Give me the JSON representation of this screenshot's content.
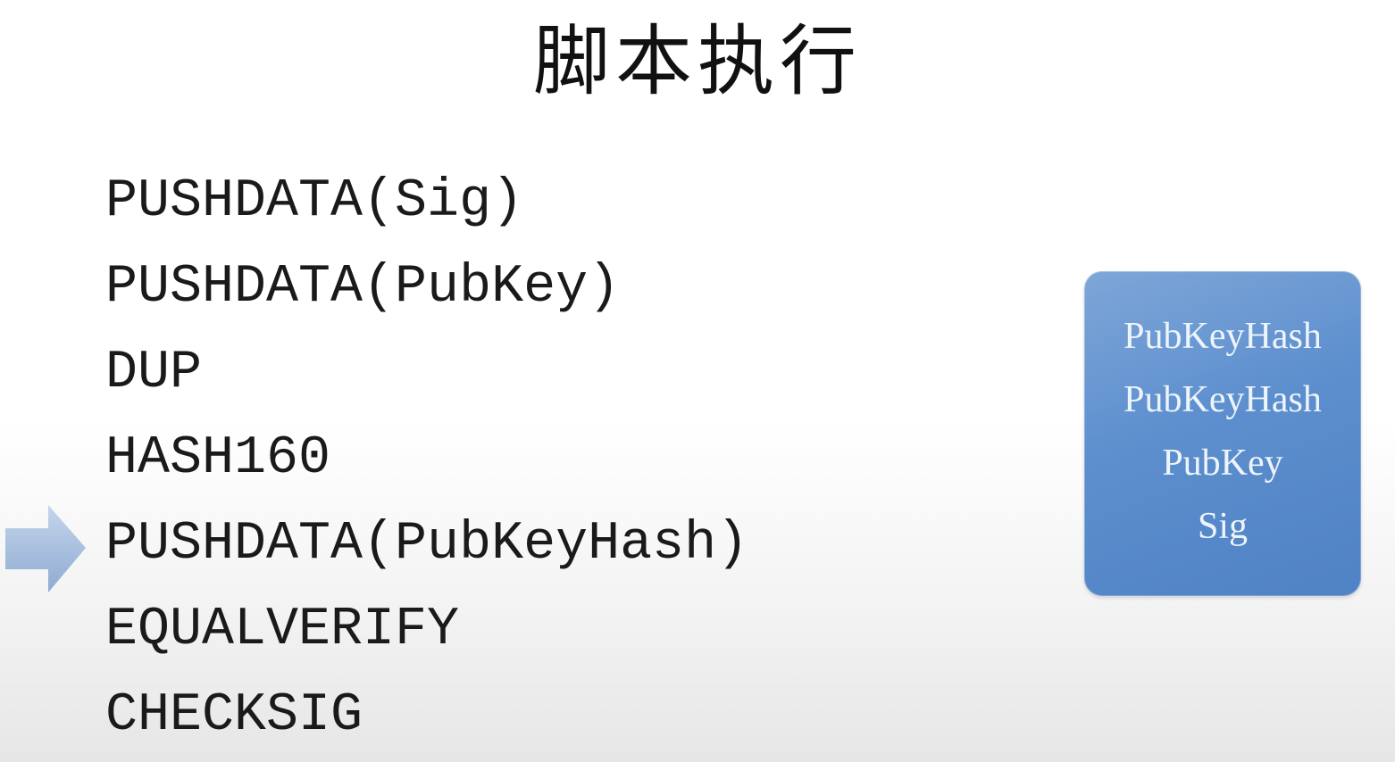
{
  "title": "脚本执行",
  "script": {
    "ops": [
      "PUSHDATA(Sig)",
      "PUSHDATA(PubKey)",
      "DUP",
      "HASH160",
      "PUSHDATA(PubKeyHash)",
      "EQUALVERIFY",
      "CHECKSIG"
    ],
    "current_index": 4
  },
  "stack": {
    "items": [
      "PubKeyHash",
      "PubKeyHash",
      "PubKey",
      "Sig"
    ]
  },
  "colors": {
    "stack_fill": "#5d8fce",
    "arrow_fill": "#a9c0de",
    "text": "#1a1a1a"
  },
  "icons": {
    "pointer": "right-arrow-icon"
  }
}
